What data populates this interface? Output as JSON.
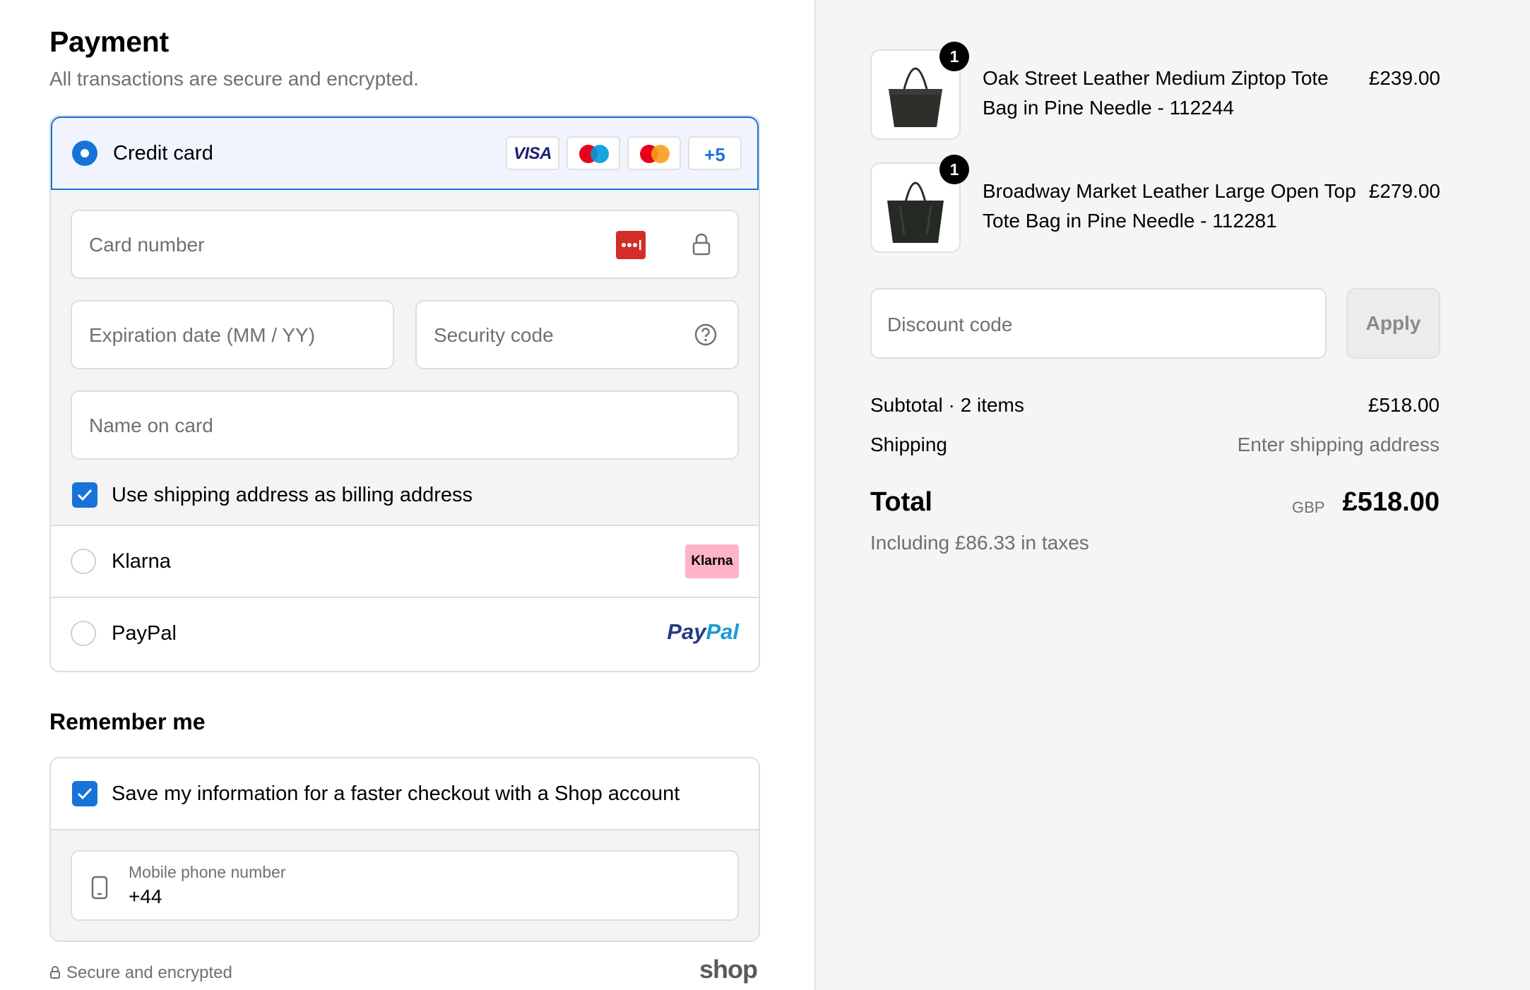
{
  "payment": {
    "title": "Payment",
    "subtitle": "All transactions are secure and encrypted.",
    "credit_card": {
      "label": "Credit card",
      "brands": [
        "VISA",
        "maestro",
        "mastercard"
      ],
      "more_brands": "+5"
    },
    "fields": {
      "card_number": "Card number",
      "expiration": "Expiration date (MM / YY)",
      "security_code": "Security code",
      "name_on_card": "Name on card"
    },
    "billing_checkbox": "Use shipping address as billing address",
    "klarna": {
      "label": "Klarna",
      "logo": "Klarna"
    },
    "paypal": {
      "label": "PayPal",
      "logo_a": "Pay",
      "logo_b": "Pal"
    }
  },
  "remember": {
    "title": "Remember me",
    "save_checkbox": "Save my information for a faster checkout with a Shop account",
    "phone_label": "Mobile phone number",
    "phone_value": "+44"
  },
  "footer": {
    "secure": "Secure and encrypted",
    "shop_logo": "shop"
  },
  "cart": {
    "items": [
      {
        "name": "Oak Street Leather Medium Ziptop Tote Bag in Pine Needle - 112244",
        "price": "£239.00",
        "qty": "1"
      },
      {
        "name": "Broadway Market Leather Large Open Top Tote Bag in Pine Needle - 112281",
        "price": "£279.00",
        "qty": "1"
      }
    ],
    "discount_placeholder": "Discount code",
    "apply_label": "Apply",
    "subtotal_label": "Subtotal · 2 items",
    "subtotal_value": "£518.00",
    "shipping_label": "Shipping",
    "shipping_value": "Enter shipping address",
    "total_label": "Total",
    "currency": "GBP",
    "total_value": "£518.00",
    "taxes_note": "Including £86.33 in taxes"
  },
  "colors": {
    "accent": "#1773d7",
    "selected_bg": "#f1f4fe",
    "lastpass_red": "#d32d27",
    "klarna_pink": "#ffb3c7"
  }
}
